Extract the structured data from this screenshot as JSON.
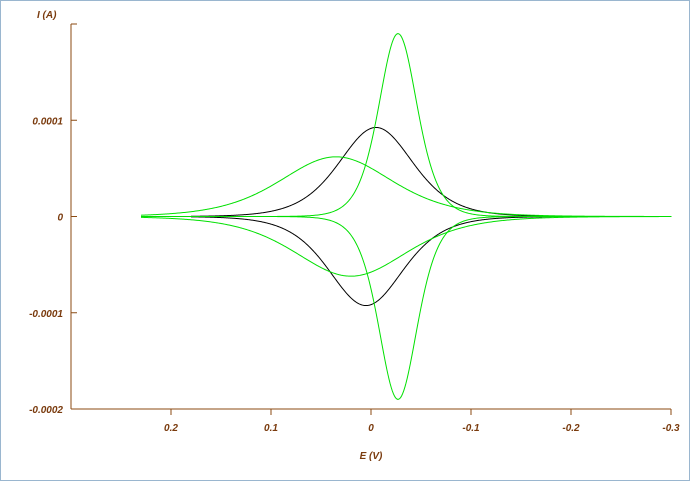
{
  "chart_data": {
    "type": "line",
    "xlabel": "E (V)",
    "ylabel": "I (A)",
    "xlim": [
      0.3,
      -0.3
    ],
    "ylim": [
      -0.0002,
      0.0002
    ],
    "x_ticks": [
      {
        "value": 0.2,
        "label": "0.2"
      },
      {
        "value": 0.1,
        "label": "0.1"
      },
      {
        "value": 0,
        "label": "0"
      },
      {
        "value": -0.1,
        "label": "-0.1"
      },
      {
        "value": -0.2,
        "label": "-0.2"
      },
      {
        "value": -0.3,
        "label": "-0.3"
      }
    ],
    "y_ticks": [
      {
        "value": 0.0001,
        "label": "0.0001"
      },
      {
        "value": 0,
        "label": "0"
      },
      {
        "value": -0.0001,
        "label": "-0.0001"
      },
      {
        "value": -0.0002,
        "label": "-0.0002"
      }
    ],
    "grid": false,
    "legend": "none",
    "axis_color": "#8b4a12",
    "series": [
      {
        "color": "#000000",
        "x_range": [
          0.18,
          -0.18
        ],
        "forward_peak": {
          "x": -0.005,
          "y": 9.25e-05,
          "width": 0.05
        },
        "reverse_peak": {
          "x": 0.005,
          "y": -9.25e-05,
          "width": 0.05
        }
      },
      {
        "color": "#00e000",
        "x_range": [
          0.23,
          -0.3
        ],
        "forward_peak": {
          "x": -0.027,
          "y": 0.00019,
          "width": 0.026
        },
        "reverse_peak": {
          "x": -0.027,
          "y": -0.00019,
          "width": 0.026
        }
      },
      {
        "color": "#00e000",
        "x_range": [
          0.23,
          -0.3
        ],
        "forward_peak": {
          "x": 0.035,
          "y": 6.2e-05,
          "width": 0.075
        },
        "reverse_peak": {
          "x": 0.02,
          "y": -6.2e-05,
          "width": 0.075
        }
      }
    ]
  }
}
